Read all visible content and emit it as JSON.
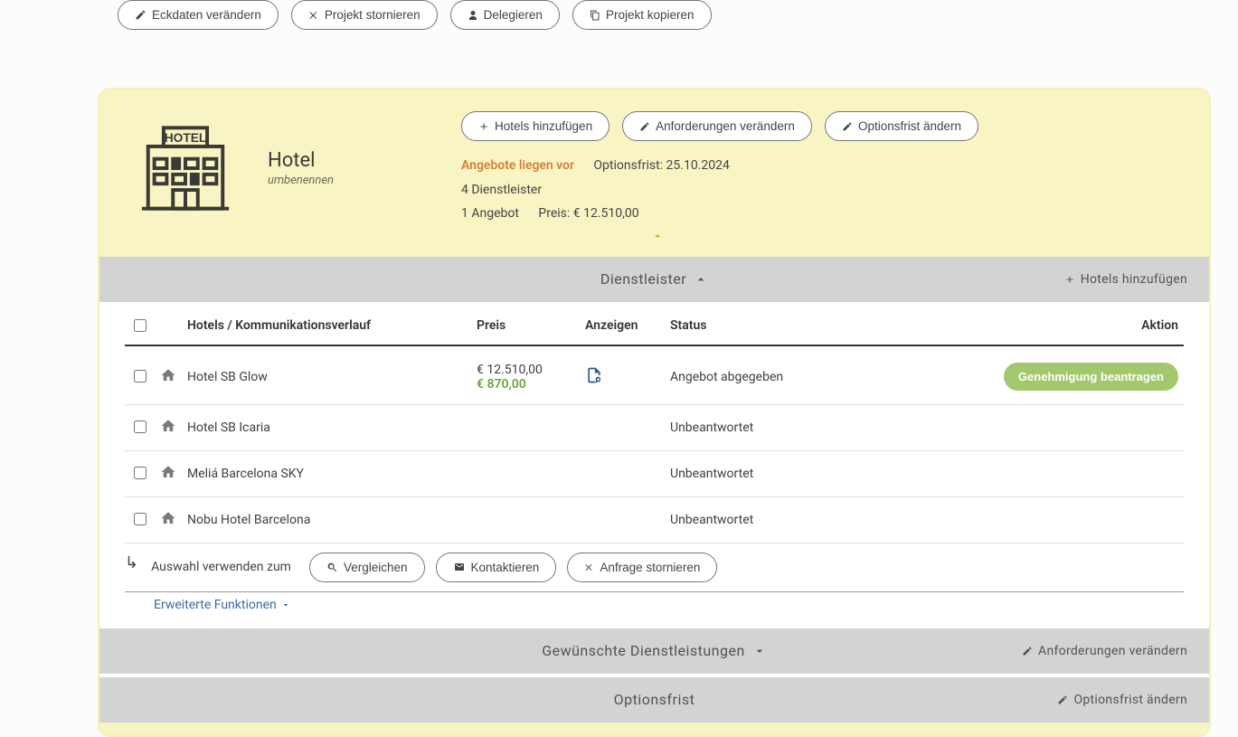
{
  "topActions": {
    "edit": "Eckdaten verändern",
    "cancel": "Projekt stornieren",
    "delegate": "Delegieren",
    "copy": "Projekt kopieren"
  },
  "hotelBlock": {
    "title": "Hotel",
    "rename": "umbenennen",
    "buttons": {
      "add": "Hotels hinzufügen",
      "reqChange": "Anforderungen verändern",
      "optChange": "Optionsfrist ändern"
    },
    "offersAvailable": "Angebote liegen vor",
    "optDeadlineLabel": "Optionsfrist: 25.10.2024",
    "providerCount": "4 Dienstleister",
    "offerCount": "1 Angebot",
    "priceLabel": "Preis: € 12.510,00"
  },
  "dienstleisterBar": {
    "title": "Dienstleister",
    "add": "Hotels hinzufügen"
  },
  "table": {
    "headers": {
      "name": "Hotels / Kommunikationsverlauf",
      "price": "Preis",
      "show": "Anzeigen",
      "status": "Status",
      "action": "Aktion"
    },
    "rows": [
      {
        "name": "Hotel SB Glow",
        "price": "€ 12.510,00",
        "priceSub": "€ 870,00",
        "showDoc": true,
        "status": "Angebot abgegeben",
        "actionButton": "Genehmigung beantragen"
      },
      {
        "name": "Hotel SB Icaria",
        "price": "",
        "priceSub": "",
        "showDoc": false,
        "status": "Unbeantwortet",
        "actionButton": ""
      },
      {
        "name": "Meliá Barcelona SKY",
        "price": "",
        "priceSub": "",
        "showDoc": false,
        "status": "Unbeantwortet",
        "actionButton": ""
      },
      {
        "name": "Nobu Hotel Barcelona",
        "price": "",
        "priceSub": "",
        "showDoc": false,
        "status": "Unbeantwortet",
        "actionButton": ""
      }
    ]
  },
  "selection": {
    "label": "Auswahl verwenden zum",
    "compare": "Vergleichen",
    "contact": "Kontaktieren",
    "cancelReq": "Anfrage stornieren"
  },
  "advanced": "Erweiterte Funktionen",
  "servicesBar": {
    "title": "Gewünschte Dienstleistungen",
    "link": "Anforderungen verändern"
  },
  "optBar": {
    "title": "Optionsfrist",
    "link": "Optionsfrist ändern"
  }
}
